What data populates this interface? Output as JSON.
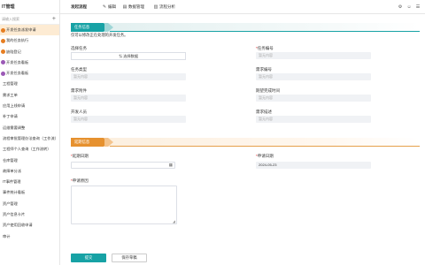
{
  "sidebar": {
    "title": "IT管理",
    "search_placeholder": "请输入搜索",
    "add_label": "+",
    "items": [
      {
        "label": "开发任务派发申请",
        "active": true,
        "dot": "#e67e22"
      },
      {
        "label": "我的任务执行",
        "active": false,
        "dot": "#e67e22"
      },
      {
        "label": "缺陷登记",
        "active": false,
        "dot": "#e67e22"
      },
      {
        "label": "开发任务看板",
        "active": false,
        "dot": "#9b59b6"
      },
      {
        "label": "开发任务看板",
        "active": false,
        "dot": "#9b59b6"
      },
      {
        "label": "工程管理"
      },
      {
        "label": "需求工单"
      },
      {
        "label": "应用上线申请"
      },
      {
        "label": "补丁申请"
      },
      {
        "label": "运维需要调整"
      },
      {
        "label": "流程审批管理办法查询（工作流）"
      },
      {
        "label": "工程师个人查询（工作流转）"
      },
      {
        "label": "仓库管理"
      },
      {
        "label": "故障单分派"
      },
      {
        "label": "IT事件管理"
      },
      {
        "label": "事件统计看板"
      },
      {
        "label": "资产管理"
      },
      {
        "label": "资产信息卡片"
      },
      {
        "label": "资产使用回收申请"
      },
      {
        "label": "审计"
      }
    ]
  },
  "topbar": {
    "tabs": [
      "发起流程",
      "编辑",
      "数据管理",
      "流程分析"
    ],
    "icons": [
      "edit-icon",
      "data-icon",
      "chart-icon",
      "settings-icon",
      "user-icon",
      "menu-icon"
    ]
  },
  "form": {
    "section1_title": "任务信息",
    "hint": "仅可以修改正在处理的开发任务。",
    "select_task_label": "选择任务",
    "select_data_btn": "⇅ 选择数据",
    "task_no_label": "任务编号",
    "task_type_label": "任务类型",
    "req_no_label": "需求编号",
    "req_attach_label": "需求附件",
    "expect_time_label": "期望完成时间",
    "developer_label": "开发人员",
    "req_desc_label": "需求描述",
    "auto_placeholder": "暂无内容",
    "section2_title": "延期信息",
    "delay_date_label": "延期日期",
    "apply_date_label": "申请日期",
    "apply_date_value": "2024-05-23",
    "reason_label": "申请原因",
    "required_mark": "*",
    "calendar_icon": "calendar-icon"
  },
  "actions": {
    "submit": "提交",
    "save_draft": "保存草稿"
  },
  "colors": {
    "accent": "#17a2a5",
    "secondary": "#e6912f",
    "active_bg": "#fdebd3"
  }
}
